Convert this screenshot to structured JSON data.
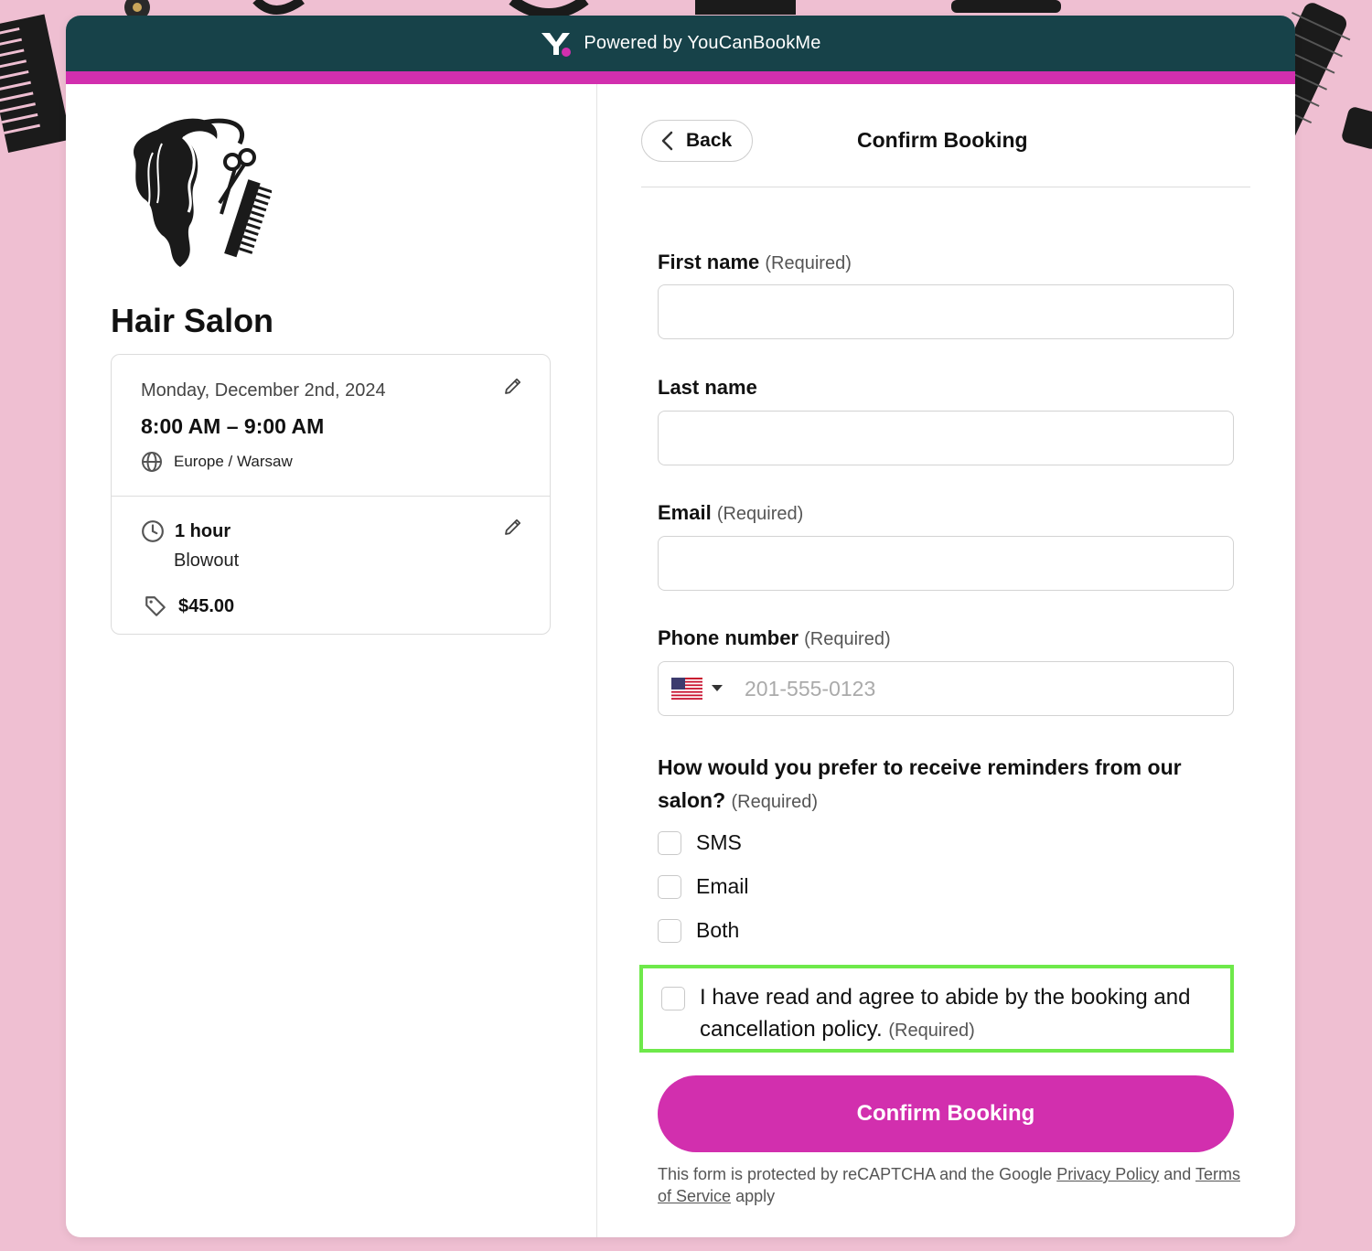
{
  "header": {
    "powered_by": "Powered by YouCanBookMe",
    "brand_color": "#174249",
    "accent_color": "#d22fae"
  },
  "sidebar": {
    "salon_name": "Hair Salon",
    "logo_icon": "hair-salon-logo",
    "booking": {
      "date": "Monday, December 2nd, 2024",
      "time_range": "8:00 AM – 9:00 AM",
      "timezone": "Europe / Warsaw",
      "duration": "1 hour",
      "service": "Blowout",
      "price": "$45.00"
    }
  },
  "form": {
    "back_label": "Back",
    "title": "Confirm Booking",
    "first_name": {
      "label": "First name",
      "required": "(Required)",
      "value": ""
    },
    "last_name": {
      "label": "Last name",
      "value": ""
    },
    "email": {
      "label": "Email",
      "required": "(Required)",
      "value": ""
    },
    "phone": {
      "label": "Phone number",
      "required": "(Required)",
      "placeholder": "201-555-0123",
      "country_flag": "us-flag"
    },
    "reminder": {
      "question": "How would you prefer to receive reminders from our salon?",
      "required": "(Required)",
      "options": [
        "SMS",
        "Email",
        "Both"
      ]
    },
    "policy": {
      "text": "I have read and agree to abide by the booking and cancellation policy.",
      "required": "(Required)",
      "highlight_color": "#6ee94a"
    },
    "confirm_label": "Confirm Booking",
    "recaptcha": {
      "prefix": "This form is protected by reCAPTCHA and the Google",
      "privacy_link": "Privacy Policy",
      "middle": "and",
      "terms_link": "Terms of Service",
      "suffix": "apply"
    }
  }
}
